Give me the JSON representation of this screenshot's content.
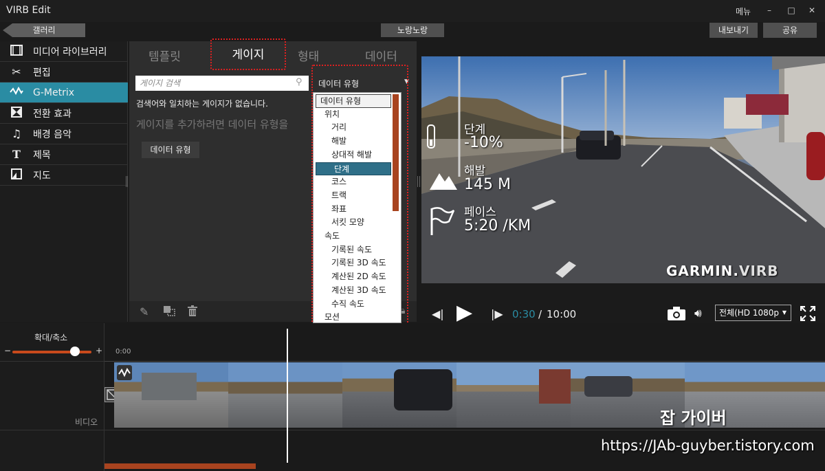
{
  "window": {
    "title": "VIRB Edit",
    "menu_label": "메뉴",
    "minimize": "–",
    "maximize": "□",
    "close": "✕"
  },
  "toolbar": {
    "gallery_label": "갤러리",
    "project_name": "노랑노랑",
    "export_label": "내보내기",
    "share_label": "공유"
  },
  "sidebar": {
    "items": [
      {
        "label": "미디어 라이브러리",
        "icon": "film-icon"
      },
      {
        "label": "편집",
        "icon": "scissors-icon"
      },
      {
        "label": "G-Metrix",
        "icon": "gmetrix-icon",
        "active": true
      },
      {
        "label": "전환 효과",
        "icon": "transition-icon"
      },
      {
        "label": "배경 음악",
        "icon": "music-note-icon"
      },
      {
        "label": "제목",
        "icon": "text-icon"
      },
      {
        "label": "지도",
        "icon": "map-icon"
      }
    ]
  },
  "gauge_panel": {
    "tabs": [
      "템플릿",
      "게이지",
      "형태",
      "데이터"
    ],
    "active_tab": "게이지",
    "search_placeholder": "게이지 검색",
    "no_match_text": "검색어와 일치하는 게이지가 없습니다.",
    "add_hint": "게이지를 추가하려면 데이터 유형을",
    "datatype_button": "데이터 유형"
  },
  "dropdown": {
    "header": "데이터 유형",
    "items": [
      {
        "label": "데이터 유형",
        "level": 0
      },
      {
        "label": "위치",
        "level": 1
      },
      {
        "label": "거리",
        "level": 2
      },
      {
        "label": "해발",
        "level": 2
      },
      {
        "label": "상대적 해발",
        "level": 2
      },
      {
        "label": "단계",
        "level": 2,
        "selected": true
      },
      {
        "label": "코스",
        "level": 2
      },
      {
        "label": "트랙",
        "level": 2
      },
      {
        "label": "좌표",
        "level": 2
      },
      {
        "label": "서킷 모양",
        "level": 2
      },
      {
        "label": "속도",
        "level": 1
      },
      {
        "label": "기록된 속도",
        "level": 2
      },
      {
        "label": "기록된 3D 속도",
        "level": 2
      },
      {
        "label": "계산된 2D 속도",
        "level": 2
      },
      {
        "label": "계산된 3D 속도",
        "level": 2
      },
      {
        "label": "수직 속도",
        "level": 2
      },
      {
        "label": "모션",
        "level": 1
      }
    ]
  },
  "overlay": {
    "grade_label": "단계",
    "grade_value": "-10%",
    "elev_label": "해발",
    "elev_value": "145 M",
    "pace_label": "페이스",
    "pace_value": "5:20 /KM",
    "brand_a": "GARMIN.",
    "brand_b": "VIRB"
  },
  "player": {
    "current_time": "0:30",
    "separator": "/",
    "total_time": "10:00",
    "quality": "전체(HD 1080p"
  },
  "timeline": {
    "zoom_label": "확대/축소",
    "zoom_minus": "−",
    "zoom_plus": "+",
    "zoom_level": 0.78,
    "start_time": "0:00",
    "track_label": "비디오"
  },
  "watermark": {
    "title": "잡 가이버",
    "url": "https://JAb-guyber.tistory.com"
  }
}
